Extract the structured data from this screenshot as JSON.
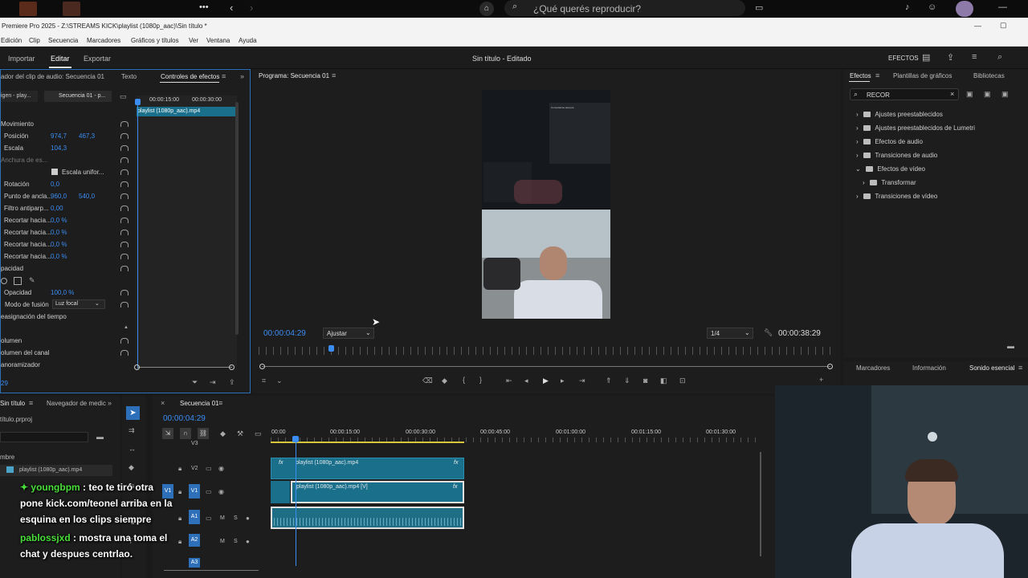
{
  "browser": {
    "search_placeholder": "¿Qué querés reproducir?",
    "more": "•••"
  },
  "window": {
    "title": "Premiere Pro 2025 - Z:\\STREAMS KICK\\playlist (1080p_aac)\\Sin título *"
  },
  "menu": [
    "Edición",
    "Clip",
    "Secuencia",
    "Marcadores",
    "Gráficos y títulos",
    "Ver",
    "Ventana",
    "Ayuda"
  ],
  "workspace": {
    "tabs": [
      "Importar",
      "Editar",
      "Exportar"
    ],
    "active_tab": "Editar",
    "project_title": "Sin título - Editado",
    "effects_label": "EFECTOS"
  },
  "effect_controls": {
    "tabs": [
      "ador del clip de audio: Secuencia 01",
      "Texto",
      "Controles de efectos"
    ],
    "source_label": "igen - play...",
    "seq_label": "Secuencia 01 - p...",
    "ruler": [
      "00:00:15:00",
      "00:00:30:00"
    ],
    "clip_name": "playlist (1080p_aac).mp4",
    "rows": [
      {
        "label": "Movimiento",
        "v1": "",
        "v2": ""
      },
      {
        "label": "Posición",
        "v1": "974,7",
        "v2": "467,3"
      },
      {
        "label": "Escala",
        "v1": "104,3",
        "v2": ""
      },
      {
        "label": "Anchura de es...",
        "v1": "",
        "v2": ""
      },
      {
        "label": "Escala unifor...",
        "v1": "",
        "v2": ""
      },
      {
        "label": "Rotación",
        "v1": "0,0",
        "v2": ""
      },
      {
        "label": "Punto de ancla...",
        "v1": "960,0",
        "v2": "540,0"
      },
      {
        "label": "Filtro antiparp...",
        "v1": "0,00",
        "v2": ""
      },
      {
        "label": "Recortar hacia...",
        "v1": "0,0 %",
        "v2": ""
      },
      {
        "label": "Recortar hacia...",
        "v1": "0,0 %",
        "v2": ""
      },
      {
        "label": "Recortar hacia...",
        "v1": "0,0 %",
        "v2": ""
      },
      {
        "label": "Recortar hacia...",
        "v1": "0,0 %",
        "v2": ""
      },
      {
        "label": "pacidad",
        "v1": "",
        "v2": ""
      }
    ],
    "opacity_label": "Opacidad",
    "opacity_value": "100,0 %",
    "blend_label": "Modo de fusión",
    "blend_value": "Luz focal",
    "time_remap": "easignación del tiempo",
    "audio_rows": [
      "olumen",
      "olumen del canal",
      "anoramizador"
    ],
    "timecode": "29"
  },
  "program": {
    "title": "Programa: Secuencia 01",
    "timecode": "00:00:04:29",
    "fit": "Ajustar",
    "quality": "1/4",
    "duration": "00:00:38:29",
    "overlay_text": "Comentarios siempre"
  },
  "effects_panel": {
    "tabs": [
      "Efectos",
      "Plantillas de gráficos",
      "Bibliotecas"
    ],
    "search_value": "RECOR",
    "tree": [
      {
        "label": "Ajustes preestablecidos",
        "level": 0,
        "open": false
      },
      {
        "label": "Ajustes preestablecidos de Lumetri",
        "level": 0,
        "open": false
      },
      {
        "label": "Efectos de audio",
        "level": 0,
        "open": false
      },
      {
        "label": "Transiciones de audio",
        "level": 0,
        "open": false
      },
      {
        "label": "Efectos de vídeo",
        "level": 0,
        "open": true
      },
      {
        "label": "Transformar",
        "level": 1,
        "open": false
      },
      {
        "label": "Transiciones de vídeo",
        "level": 0,
        "open": false
      }
    ],
    "bottom_tabs": [
      "Marcadores",
      "Información",
      "Sonido esencial"
    ]
  },
  "project": {
    "tabs": [
      "Sin título",
      "Navegador de medic"
    ],
    "file": "título.prproj",
    "name_col": "mbre",
    "item": "playlist (1080p_aac).mp4"
  },
  "timeline": {
    "tab": "Secuencia 01",
    "timecode": "00:00:04:29",
    "ruler": [
      "00:00",
      "00:00:15:00",
      "00:00:30:00",
      "00:00:45:00",
      "00:01:00:00",
      "00:01:15:00",
      "00:01:30:00"
    ],
    "tracks": [
      "V3",
      "V2",
      "V1",
      "A1",
      "A2",
      "A3"
    ],
    "clip_v2": "playlist (1080p_aac).mp4",
    "clip_v1": "playlist (1080p_aac).mp4 [V]"
  },
  "chat": [
    {
      "user": "youngbpm",
      "msg": " : teo te tiró otra",
      "cont": [
        "pone kick.com/teonel arriba en la",
        "esquina en los clips siempre"
      ]
    },
    {
      "user": "pablossjxd",
      "msg": " : mostra una toma el",
      "cont": [
        "chat y despues centrlao."
      ]
    }
  ]
}
